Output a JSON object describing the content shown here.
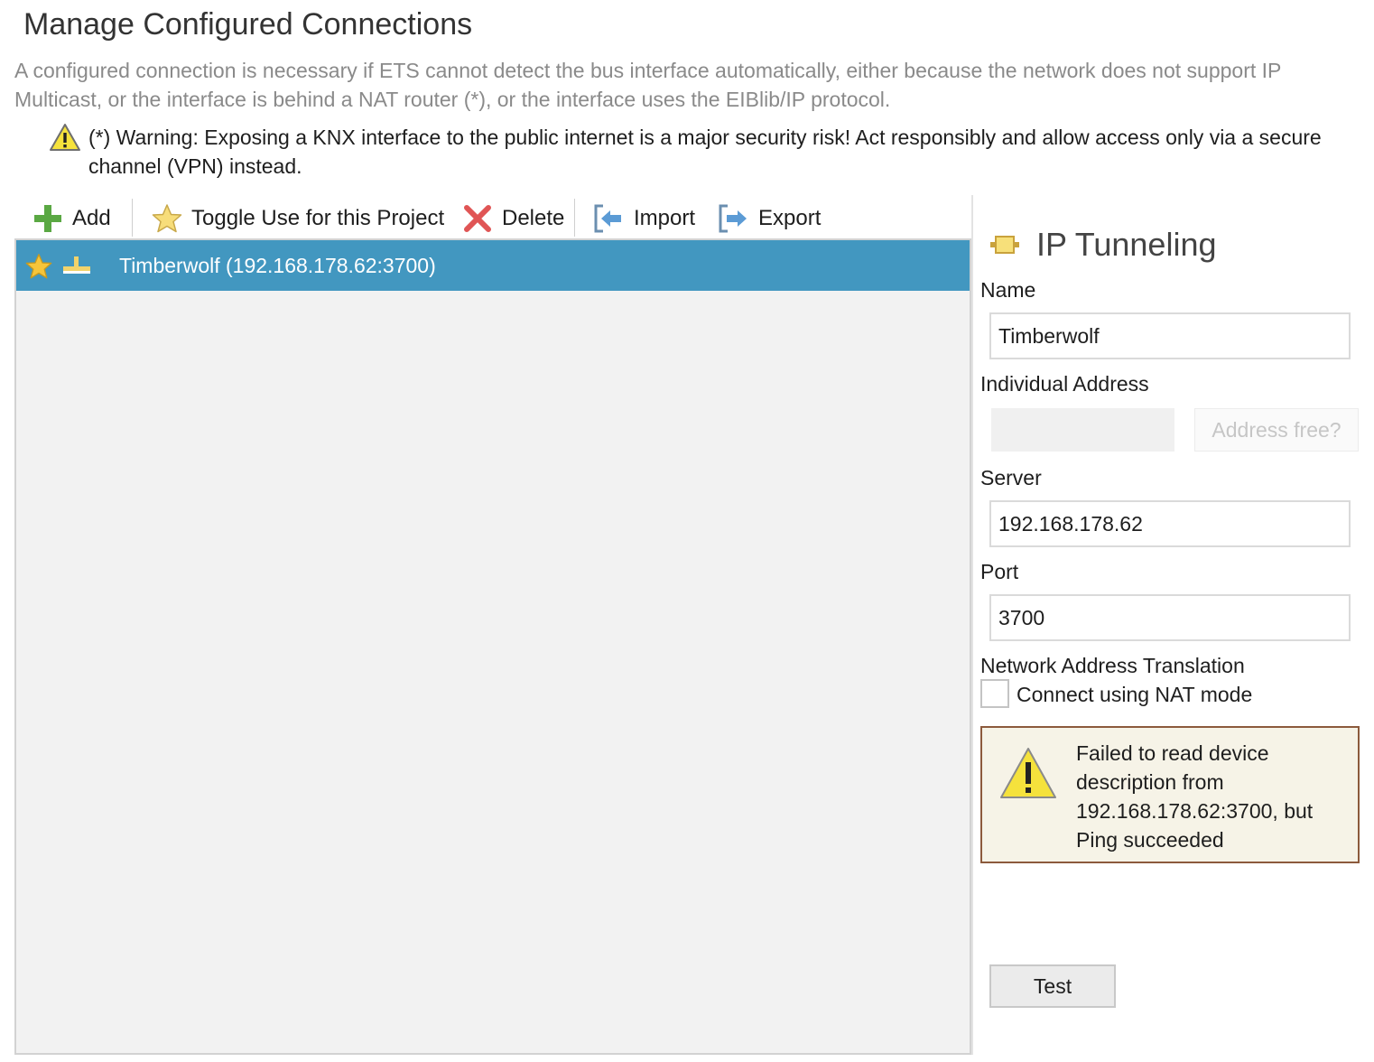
{
  "header": {
    "title": "Manage Configured Connections",
    "description": "A configured connection is necessary if ETS cannot detect the bus interface automatically, either because the network does not support IP Multicast, or the interface is behind a NAT router (*), or the interface uses the EIBlib/IP protocol.",
    "warning": "(*) Warning: Exposing a KNX interface to the public internet is a major security risk! Act responsibly and allow access only via a secure channel (VPN) instead."
  },
  "toolbar": {
    "add_label": "Add",
    "toggle_label": "Toggle Use for this Project",
    "delete_label": "Delete",
    "import_label": "Import",
    "export_label": "Export"
  },
  "connections": [
    {
      "label": "Timberwolf (192.168.178.62:3700)",
      "selected": true,
      "starred": true
    }
  ],
  "detail": {
    "title": "IP Tunneling",
    "name_label": "Name",
    "name_value": "Timberwolf",
    "individual_address_label": "Individual Address",
    "individual_address_value": "",
    "address_free_label": "Address free?",
    "server_label": "Server",
    "server_value": "192.168.178.62",
    "port_label": "Port",
    "port_value": "3700",
    "nat_section_label": "Network Address Translation",
    "nat_checkbox_label": "Connect using NAT mode",
    "nat_checked": false,
    "alert_text": "Failed to read device description from 192.168.178.62:3700, but Ping succeeded",
    "test_label": "Test"
  },
  "colors": {
    "selection": "#4297c0",
    "alert_background": "#f6f3e7",
    "alert_border": "#8c5a3c",
    "warning_yellow": "#f5e23c"
  }
}
